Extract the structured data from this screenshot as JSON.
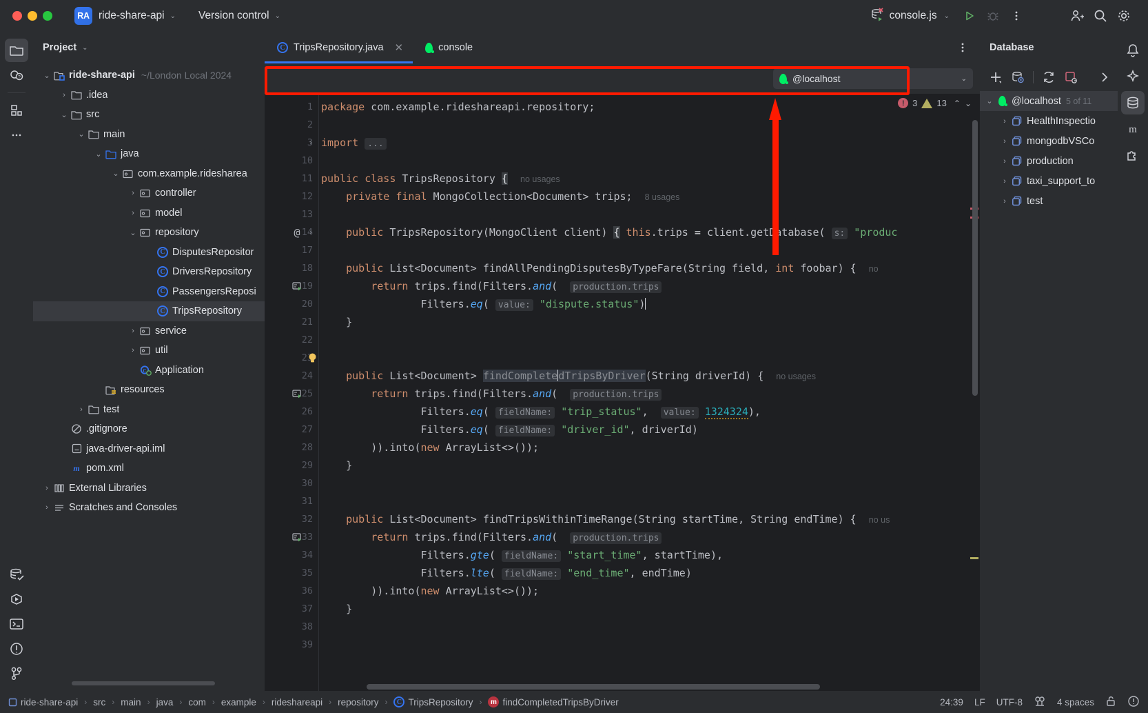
{
  "titlebar": {
    "project_badge": "RA",
    "project_name": "ride-share-api",
    "vcs_label": "Version control",
    "run_config": "console.js",
    "chevron": "⌄"
  },
  "left_rail": [
    {
      "name": "project-tool-window",
      "icon": "folder-icon",
      "active": true
    },
    {
      "name": "commit-tool-window",
      "icon": "commit-icon",
      "active": false
    },
    {
      "name": "structure-tool-window",
      "icon": "structure-icon",
      "active": false
    },
    {
      "name": "more-tool-windows",
      "icon": "ellipsis-icon",
      "active": false
    },
    {
      "name": "database-tool-window",
      "icon": "database-check-icon",
      "active": false
    },
    {
      "name": "run-tool-window",
      "icon": "run-icon",
      "active": false
    },
    {
      "name": "terminal-tool-window",
      "icon": "terminal-icon",
      "active": false
    },
    {
      "name": "problems-tool-window",
      "icon": "warning-circle-icon",
      "active": false
    },
    {
      "name": "git-tool-window",
      "icon": "git-branch-icon",
      "active": false
    }
  ],
  "project_panel": {
    "title": "Project",
    "tree": [
      {
        "depth": 0,
        "arrow": "v",
        "icon": "module-folder-icon",
        "label": "ride-share-api",
        "bold": true,
        "suffix": "~/London Local 2024",
        "selected": false
      },
      {
        "depth": 1,
        "arrow": ">",
        "icon": "folder-icon",
        "label": ".idea",
        "selected": false
      },
      {
        "depth": 1,
        "arrow": "v",
        "icon": "folder-icon",
        "label": "src",
        "selected": false
      },
      {
        "depth": 2,
        "arrow": "v",
        "icon": "folder-icon",
        "label": "main",
        "selected": false
      },
      {
        "depth": 3,
        "arrow": "v",
        "icon": "source-folder-icon",
        "label": "java",
        "selected": false
      },
      {
        "depth": 4,
        "arrow": "v",
        "icon": "package-icon",
        "label": "com.example.ridesharea",
        "selected": false
      },
      {
        "depth": 5,
        "arrow": ">",
        "icon": "package-icon",
        "label": "controller",
        "selected": false
      },
      {
        "depth": 5,
        "arrow": ">",
        "icon": "package-icon",
        "label": "model",
        "selected": false
      },
      {
        "depth": 5,
        "arrow": "v",
        "icon": "package-icon",
        "label": "repository",
        "selected": false
      },
      {
        "depth": 6,
        "arrow": "",
        "icon": "java-class-icon",
        "label": "DisputesRepositor",
        "selected": false
      },
      {
        "depth": 6,
        "arrow": "",
        "icon": "java-class-icon",
        "label": "DriversRepository",
        "selected": false
      },
      {
        "depth": 6,
        "arrow": "",
        "icon": "java-class-icon",
        "label": "PassengersReposi",
        "selected": false
      },
      {
        "depth": 6,
        "arrow": "",
        "icon": "java-class-icon",
        "label": "TripsRepository",
        "selected": true
      },
      {
        "depth": 5,
        "arrow": ">",
        "icon": "package-icon",
        "label": "service",
        "selected": false
      },
      {
        "depth": 5,
        "arrow": ">",
        "icon": "package-icon",
        "label": "util",
        "selected": false
      },
      {
        "depth": 5,
        "arrow": "",
        "icon": "java-runnable-class-icon",
        "label": "Application",
        "selected": false
      },
      {
        "depth": 3,
        "arrow": "",
        "icon": "resources-folder-icon",
        "label": "resources",
        "selected": false
      },
      {
        "depth": 2,
        "arrow": ">",
        "icon": "folder-icon",
        "label": "test",
        "selected": false
      },
      {
        "depth": 1,
        "arrow": "",
        "icon": "gitignore-icon",
        "label": ".gitignore",
        "selected": false
      },
      {
        "depth": 1,
        "arrow": "",
        "icon": "iml-file-icon",
        "label": "java-driver-api.iml",
        "selected": false
      },
      {
        "depth": 1,
        "arrow": "",
        "icon": "maven-icon",
        "label": "pom.xml",
        "selected": false
      },
      {
        "depth": 0,
        "arrow": ">",
        "icon": "libraries-icon",
        "label": "External Libraries",
        "selected": false
      },
      {
        "depth": 0,
        "arrow": ">",
        "icon": "scratches-icon",
        "label": "Scratches and Consoles",
        "selected": false
      }
    ]
  },
  "tabs": [
    {
      "label": "TripsRepository.java",
      "icon": "java-class-icon",
      "active": true,
      "closable": true
    },
    {
      "label": "console",
      "icon": "mongodb-leaf-icon",
      "active": false,
      "closable": false
    }
  ],
  "connection_selector": {
    "value": "@localhost",
    "icon": "mongodb-leaf-icon",
    "chevron": "⌄"
  },
  "inspections": {
    "error_count": "3",
    "warning_count": "13",
    "up": "⌃",
    "down": "⌄"
  },
  "code": {
    "lines": [
      {
        "num": "1",
        "mark": "",
        "fold": "",
        "html": "<span class='kw'>package</span> <span class='idn'>com.example.rideshareapi.repository</span><span class='pun'>;</span>"
      },
      {
        "num": "2",
        "mark": "",
        "fold": "",
        "html": ""
      },
      {
        "num": "3",
        "mark": "",
        "fold": ">",
        "html": "<span class='kw'>import</span> <span class='hintchip'>...</span>"
      },
      {
        "num": "10",
        "mark": "",
        "fold": "",
        "html": ""
      },
      {
        "num": "11",
        "mark": "",
        "fold": "",
        "html": "<span class='kw'>public class</span> <span class='cls'>TripsRepository</span> <span class='brace-hl'>{</span>  <span class='usages'>no usages</span>"
      },
      {
        "num": "12",
        "mark": "",
        "fold": "",
        "html": "    <span class='kw'>private final</span> <span class='cls'>MongoCollection&lt;Document&gt;</span> <span class='idn'>trips</span><span class='pun'>;</span>  <span class='usages'>8 usages</span>"
      },
      {
        "num": "13",
        "mark": "",
        "fold": "",
        "html": ""
      },
      {
        "num": "14",
        "mark": "@",
        "fold": ">",
        "html": "    <span class='kw'>public</span> <span class='cls'>TripsRepository</span><span class='pun'>(</span><span class='cls'>MongoClient</span> <span class='idn'>client</span><span class='pun'>)</span> <span class='brace-hl'>{</span> <span class='kw'>this</span><span class='pun'>.</span><span class='idn'>trips</span> = <span class='idn'>client</span><span class='pun'>.</span><span class='fnd'>getDatabase</span><span class='pun'>(</span> <span class='hintchip'>s:</span> <span class='str'>\"produc</span>"
      },
      {
        "num": "17",
        "mark": "",
        "fold": "",
        "html": ""
      },
      {
        "num": "18",
        "mark": "",
        "fold": "",
        "html": "    <span class='kw'>public</span> <span class='cls'>List&lt;Document&gt;</span> <span class='fnd'>findAllPendingDisputesByTypeFare</span><span class='pun'>(</span><span class='cls'>String</span> <span class='idn'>field</span><span class='pun'>,</span> <span class='kw'>int</span> <span class='idn'>foobar</span><span class='pun'>)</span> <span class='pun'>{</span>  <span class='usages'>no</span>"
      },
      {
        "num": "19",
        "mark": "run",
        "fold": "",
        "html": "        <span class='kw'>return</span> <span class='idn'>trips</span><span class='pun'>.</span><span class='fnd'>find</span><span class='pun'>(</span><span class='cls'>Filters</span><span class='pun'>.</span><span class='fn' style='font-style:italic'>and</span><span class='pun'>(</span>  <span class='hintchip'>production.trips</span>"
      },
      {
        "num": "20",
        "mark": "",
        "fold": "",
        "html": "                <span class='cls'>Filters</span><span class='pun'>.</span><span class='fn' style='font-style:italic'>eq</span><span class='pun'>(</span> <span class='hintchip'>value:</span> <span class='str'>\"dispute.status\"</span><span class='pun'>)</span><span class='caret'></span>"
      },
      {
        "num": "21",
        "mark": "",
        "fold": "",
        "html": "    <span class='pun'>}</span>"
      },
      {
        "num": "22",
        "mark": "",
        "fold": "",
        "html": ""
      },
      {
        "num": "23",
        "mark": "bulb",
        "fold": "",
        "html": ""
      },
      {
        "num": "24",
        "mark": "",
        "fold": "",
        "html": "    <span class='kw'>public</span> <span class='cls'>List&lt;Document&gt;</span> <span class='sel-text' style='color:#8a8d93'>findComplete</span><span class='caret'></span><span class='sel-text' style='color:#8a8d93'>dTripsByDriver</span><span class='pun'>(</span><span class='cls'>String</span> <span class='idn'>driverId</span><span class='pun'>)</span> <span class='pun'>{</span>  <span class='usages'>no usages</span>"
      },
      {
        "num": "25",
        "mark": "run",
        "fold": "",
        "html": "        <span class='kw'>return</span> <span class='idn'>trips</span><span class='pun'>.</span><span class='fnd'>find</span><span class='pun'>(</span><span class='cls'>Filters</span><span class='pun'>.</span><span class='fn' style='font-style:italic'>and</span><span class='pun'>(</span>  <span class='hintchip'>production.trips</span>"
      },
      {
        "num": "26",
        "mark": "",
        "fold": "",
        "html": "                <span class='cls'>Filters</span><span class='pun'>.</span><span class='fn' style='font-style:italic'>eq</span><span class='pun'>(</span> <span class='hintchip'>fieldName:</span> <span class='str'>\"trip_status\"</span><span class='pun'>,</span>  <span class='hintchip'>value:</span> <span class='num squig'>1324324</span><span class='pun'>),</span>"
      },
      {
        "num": "27",
        "mark": "",
        "fold": "",
        "html": "                <span class='cls'>Filters</span><span class='pun'>.</span><span class='fn' style='font-style:italic'>eq</span><span class='pun'>(</span> <span class='hintchip'>fieldName:</span> <span class='str'>\"driver_id\"</span><span class='pun'>,</span> <span class='idn'>driverId</span><span class='pun'>)</span>"
      },
      {
        "num": "28",
        "mark": "",
        "fold": "",
        "html": "        <span class='pun'>)).</span><span class='fnd'>into</span><span class='pun'>(</span><span class='kw'>new</span> <span class='cls'>ArrayList</span><span class='pun'>&lt;&gt;());</span>"
      },
      {
        "num": "29",
        "mark": "",
        "fold": "",
        "html": "    <span class='pun'>}</span>"
      },
      {
        "num": "30",
        "mark": "",
        "fold": "",
        "html": ""
      },
      {
        "num": "31",
        "mark": "",
        "fold": "",
        "html": ""
      },
      {
        "num": "32",
        "mark": "",
        "fold": "",
        "html": "    <span class='kw'>public</span> <span class='cls'>List&lt;Document&gt;</span> <span class='fnd'>findTripsWithinTimeRange</span><span class='pun'>(</span><span class='cls'>String</span> <span class='idn'>startTime</span><span class='pun'>,</span> <span class='cls'>String</span> <span class='idn'>endTime</span><span class='pun'>)</span> <span class='pun'>{</span>  <span class='usages'>no us</span>"
      },
      {
        "num": "33",
        "mark": "run",
        "fold": "",
        "html": "        <span class='kw'>return</span> <span class='idn'>trips</span><span class='pun'>.</span><span class='fnd'>find</span><span class='pun'>(</span><span class='cls'>Filters</span><span class='pun'>.</span><span class='fn' style='font-style:italic'>and</span><span class='pun'>(</span>  <span class='hintchip'>production.trips</span>"
      },
      {
        "num": "34",
        "mark": "",
        "fold": "",
        "html": "                <span class='cls'>Filters</span><span class='pun'>.</span><span class='fn' style='font-style:italic'>gte</span><span class='pun'>(</span> <span class='hintchip'>fieldName:</span> <span class='str'>\"start_time\"</span><span class='pun'>,</span> <span class='idn'>startTime</span><span class='pun'>),</span>"
      },
      {
        "num": "35",
        "mark": "",
        "fold": "",
        "html": "                <span class='cls'>Filters</span><span class='pun'>.</span><span class='fn' style='font-style:italic'>lte</span><span class='pun'>(</span> <span class='hintchip'>fieldName:</span> <span class='str'>\"end_time\"</span><span class='pun'>,</span> <span class='idn'>endTime</span><span class='pun'>)</span>"
      },
      {
        "num": "36",
        "mark": "",
        "fold": "",
        "html": "        <span class='pun'>)).</span><span class='fnd'>into</span><span class='pun'>(</span><span class='kw'>new</span> <span class='cls'>ArrayList</span><span class='pun'>&lt;&gt;());</span>"
      },
      {
        "num": "37",
        "mark": "",
        "fold": "",
        "html": "    <span class='pun'>}</span>"
      },
      {
        "num": "38",
        "mark": "",
        "fold": "",
        "html": ""
      },
      {
        "num": "39",
        "mark": "",
        "fold": "",
        "html": ""
      }
    ]
  },
  "database_panel": {
    "title": "Database",
    "toolbar": [
      {
        "name": "add-button",
        "icon": "plus-icon"
      },
      {
        "name": "data-source-properties-button",
        "icon": "database-gear-icon"
      },
      {
        "name": "refresh-button",
        "icon": "refresh-icon"
      },
      {
        "name": "stop-button",
        "icon": "stop-square-icon"
      },
      {
        "name": "expand-button",
        "icon": "chevron-right-icon"
      }
    ],
    "tree": [
      {
        "depth": 0,
        "arrow": "v",
        "icon": "mongodb-leaf-icon",
        "label": "@localhost",
        "count": "5 of 11",
        "selected": true
      },
      {
        "depth": 1,
        "arrow": ">",
        "icon": "database-icon",
        "label": "HealthInspectio",
        "count": "",
        "selected": false
      },
      {
        "depth": 1,
        "arrow": ">",
        "icon": "database-icon",
        "label": "mongodbVSCo",
        "count": "",
        "selected": false
      },
      {
        "depth": 1,
        "arrow": ">",
        "icon": "database-icon",
        "label": "production",
        "count": "",
        "selected": false
      },
      {
        "depth": 1,
        "arrow": ">",
        "icon": "database-icon",
        "label": "taxi_support_to",
        "count": "",
        "selected": false
      },
      {
        "depth": 1,
        "arrow": ">",
        "icon": "database-icon",
        "label": "test",
        "count": "",
        "selected": false
      }
    ]
  },
  "right_rail": [
    {
      "name": "notifications-tool-window",
      "icon": "bell-icon",
      "active": false
    },
    {
      "name": "ai-assistant-tool-window",
      "icon": "ai-icon",
      "active": false
    },
    {
      "name": "database-tool-window",
      "icon": "database-icon",
      "active": true
    },
    {
      "name": "maven-tool-window",
      "icon": "maven-m-icon",
      "active": false
    },
    {
      "name": "plugins-tool-window",
      "icon": "plugin-icon",
      "active": false
    }
  ],
  "statusbar": {
    "breadcrumb": [
      {
        "label": "ride-share-api",
        "icon": "module-icon"
      },
      {
        "label": "src",
        "icon": ""
      },
      {
        "label": "main",
        "icon": ""
      },
      {
        "label": "java",
        "icon": ""
      },
      {
        "label": "com",
        "icon": ""
      },
      {
        "label": "example",
        "icon": ""
      },
      {
        "label": "rideshareapi",
        "icon": ""
      },
      {
        "label": "repository",
        "icon": ""
      },
      {
        "label": "TripsRepository",
        "icon": "java-class-icon"
      },
      {
        "label": "findCompletedTripsByDriver",
        "icon": "method-icon"
      }
    ],
    "separator": "›",
    "caret_position": "24:39",
    "line_separator": "LF",
    "encoding": "UTF-8",
    "indent": "4 spaces",
    "icons": [
      "column-selection-icon",
      "lock-icon",
      "inspections-icon"
    ]
  },
  "annotation": {
    "highlight_color": "#ff1a00",
    "target": "connection-selector-bar"
  }
}
